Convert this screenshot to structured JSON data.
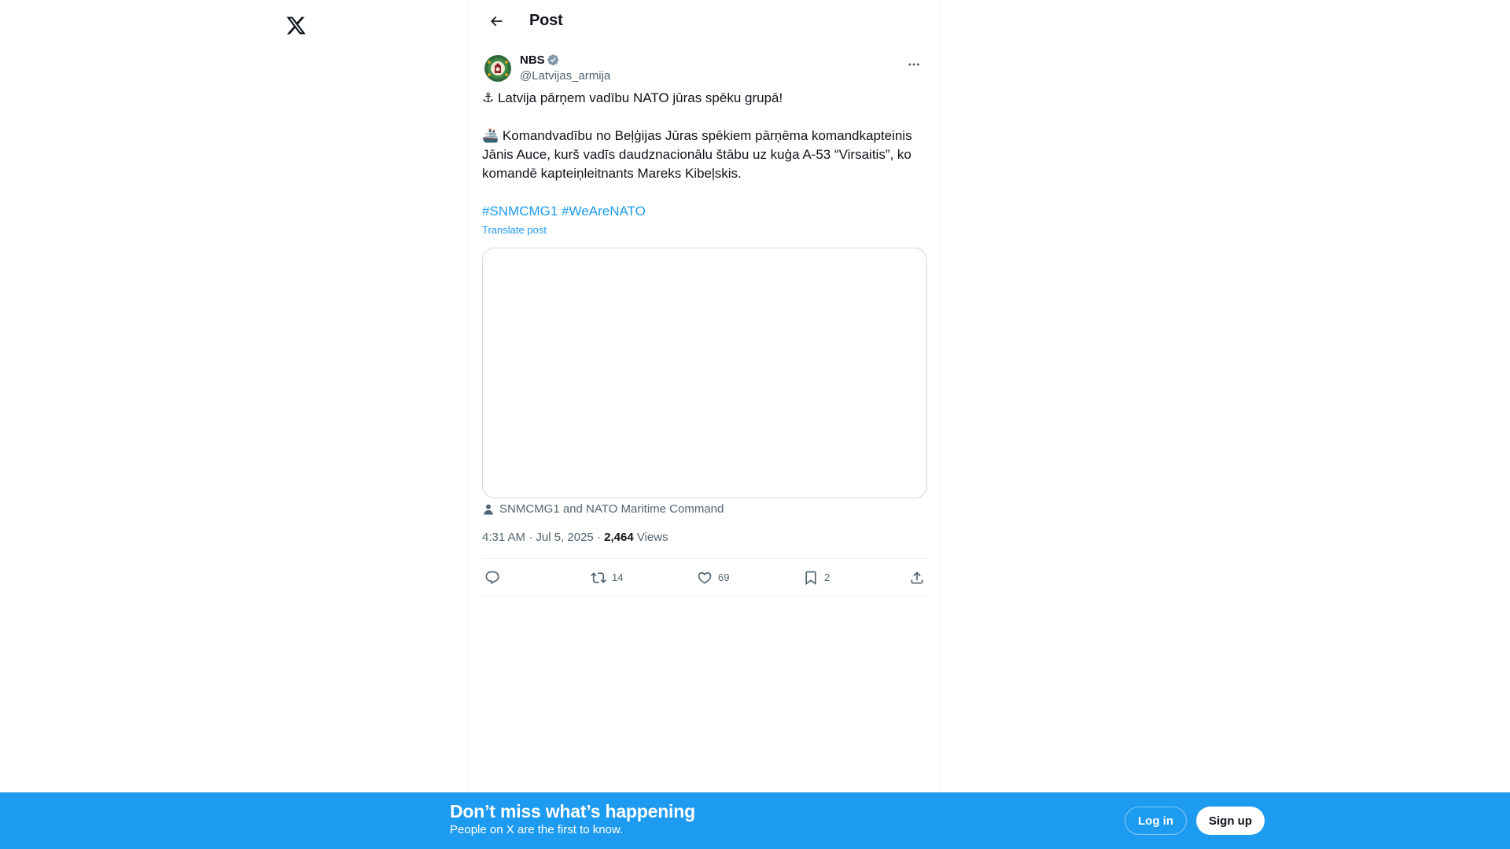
{
  "header": {
    "title": "Post"
  },
  "post": {
    "author": {
      "display_name": "NBS",
      "handle": "@Latvijas_armija",
      "verified": true
    },
    "text": {
      "line1_emoji": "⚓",
      "line1": " Latvija pārņem vadību NATO jūras spēku grupā!",
      "para2_emoji": "🚢",
      "para2": " Komandvadību no Beļģijas Jūras spēkiem pārņēma komandkapteinis Jānis Auce, kurš vadīs daudznacionālu štābu uz kuģa A-53 “Virsaitis”, ko komandē kapteiņleitnants Mareks Kibeļskis.",
      "hashtags": [
        "#SNMCMG1",
        "#WeAreNATO"
      ]
    },
    "translate_label": "Translate post",
    "tagged": "SNMCMG1 and NATO Maritime Command",
    "meta": {
      "time": "4:31 AM",
      "date": "Jul 5, 2025",
      "views_count": "2,464",
      "views_label": "Views"
    },
    "actions": {
      "replies": "",
      "reposts": "14",
      "likes": "69",
      "bookmarks": "2"
    }
  },
  "bottom_bar": {
    "headline": "Don’t miss what’s happening",
    "subtext": "People on X are the first to know.",
    "login_label": "Log in",
    "signup_label": "Sign up"
  },
  "colors": {
    "accent": "#1d9bf0",
    "text_primary": "#0f1419",
    "text_secondary": "#536471",
    "border": "#eff3f4"
  },
  "icons": {
    "logo": "x-logo-icon",
    "back": "arrow-left-icon",
    "verified": "verified-badge-icon",
    "more": "more-dots-icon",
    "tagged": "person-icon",
    "reply": "reply-icon",
    "repost": "repost-icon",
    "like": "heart-icon",
    "bookmark": "bookmark-icon",
    "share": "share-icon"
  }
}
